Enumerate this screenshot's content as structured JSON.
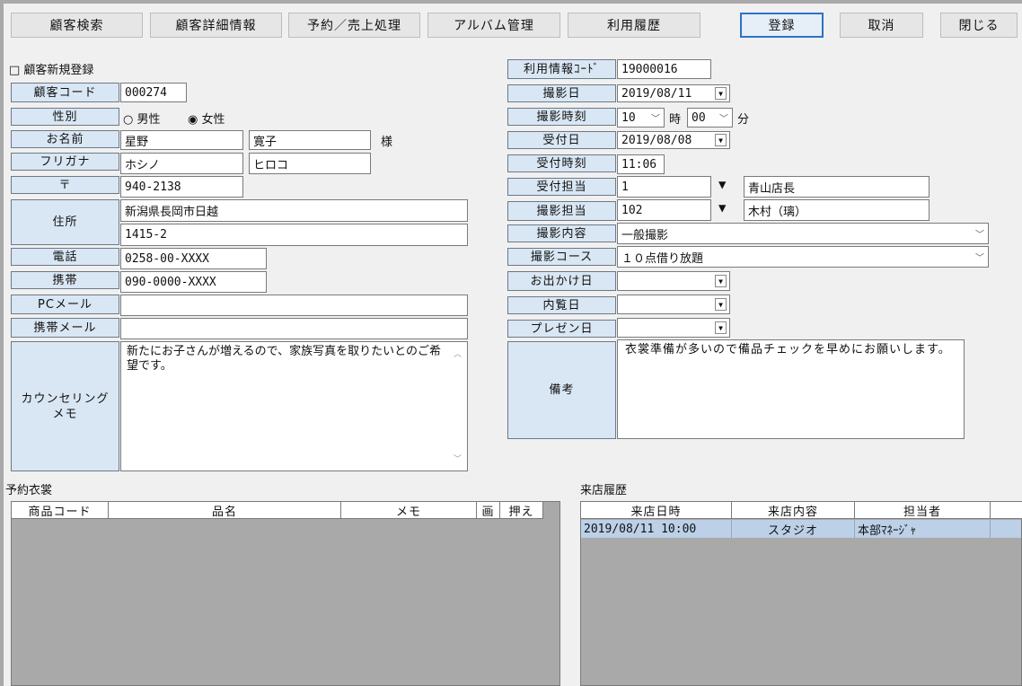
{
  "toolbar": {
    "customer_search": "顧客検索",
    "customer_detail": "顧客詳細情報",
    "reservation_sales": "予約／売上処理",
    "album": "アルバム管理",
    "history": "利用履歴",
    "register": "登録",
    "cancel": "取消",
    "close": "閉じる"
  },
  "left": {
    "new_customer_checkbox": "□ 顧客新規登録",
    "customer_code_label": "顧客コード",
    "customer_code": "000274",
    "gender_label": "性別",
    "gender_male": "○ 男性",
    "gender_female": "◉ 女性",
    "name_label": "お名前",
    "last_name": "星野",
    "first_name": "寛子",
    "honorific": "様",
    "kana_label": "フリガナ",
    "last_kana": "ホシノ",
    "first_kana": "ヒロコ",
    "zip_label": "〒",
    "zip": "940-2138",
    "address_label": "住所",
    "address1": "新潟県長岡市日越",
    "address2": "1415-2",
    "phone_label": "電話",
    "phone": "0258-00-XXXX",
    "mobile_label": "携帯",
    "mobile": "090-0000-XXXX",
    "pc_mail_label": "PCメール",
    "pc_mail": "",
    "mobile_mail_label": "携帯メール",
    "mobile_mail": "",
    "counseling_label": "カウンセリングメモ",
    "counseling_memo": "新たにお子さんが増えるので、家族写真を取りたいとのご希望です。"
  },
  "right": {
    "usage_code_label": "利用情報ｺｰﾄﾞ",
    "usage_code": "19000016",
    "shoot_date_label": "撮影日",
    "shoot_date": "2019/08/11",
    "shoot_time_label": "撮影時刻",
    "shoot_hour": "10",
    "hour_unit": "時",
    "shoot_minute": "00",
    "minute_unit": "分",
    "reception_date_label": "受付日",
    "reception_date": "2019/08/08",
    "reception_time_label": "受付時刻",
    "reception_time": "11:06",
    "reception_staff_label": "受付担当",
    "reception_staff_id": "1",
    "reception_staff_name": "青山店長",
    "photo_staff_label": "撮影担当",
    "photo_staff_id": "102",
    "photo_staff_name": "木村（璃）",
    "shoot_content_label": "撮影内容",
    "shoot_content": "一般撮影",
    "shoot_course_label": "撮影コース",
    "shoot_course": "１０点借り放題",
    "outing_date_label": "お出かけ日",
    "outing_date": "",
    "preview_date_label": "内覧日",
    "preview_date": "",
    "presentation_date_label": "プレゼン日",
    "presentation_date": "",
    "remarks_label": "備考",
    "remarks": "衣裳準備が多いので備品チェックを早めにお願いします。"
  },
  "reserved_costumes": {
    "title": "予約衣裳",
    "columns": [
      "商品コード",
      "品名",
      "メモ",
      "画",
      "押え"
    ],
    "rows": []
  },
  "visit_history": {
    "title": "来店履歴",
    "columns": [
      "来店日時",
      "来店内容",
      "担当者"
    ],
    "rows": [
      {
        "datetime": "2019/08/11 10:00",
        "content": "スタジオ",
        "staff": "本部ﾏﾈｰｼﾞｬ"
      }
    ]
  },
  "colors": {
    "label_bg": "#d9e6f3",
    "selected_row": "#bcd0e8",
    "primary_border": "#2d73c8",
    "empty_grid": "#a9a9a9"
  }
}
